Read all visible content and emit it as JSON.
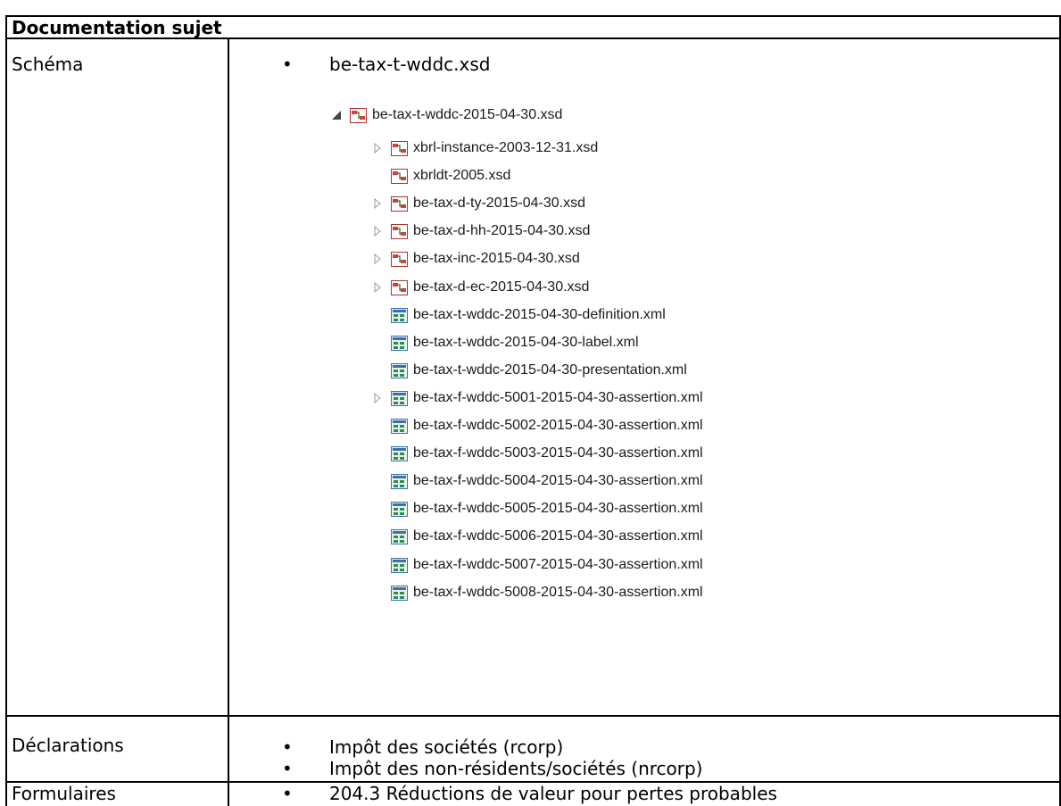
{
  "header": {
    "title": "Documentation sujet"
  },
  "schema": {
    "label": "Schéma",
    "bullet": "be-tax-t-wddc.xsd",
    "tree": {
      "root": {
        "label": "be-tax-t-wddc-2015-04-30.xsd",
        "icon": "xsd-icon",
        "expanded": true
      },
      "children": [
        {
          "label": "xbrl-instance-2003-12-31.xsd",
          "icon": "xsd-icon",
          "expandable": true
        },
        {
          "label": "xbrldt-2005.xsd",
          "icon": "xsd-icon",
          "expandable": false
        },
        {
          "label": "be-tax-d-ty-2015-04-30.xsd",
          "icon": "xsd-icon",
          "expandable": true
        },
        {
          "label": "be-tax-d-hh-2015-04-30.xsd",
          "icon": "xsd-icon",
          "expandable": true
        },
        {
          "label": "be-tax-inc-2015-04-30.xsd",
          "icon": "xsd-icon",
          "expandable": true
        },
        {
          "label": "be-tax-d-ec-2015-04-30.xsd",
          "icon": "xsd-icon",
          "expandable": true
        },
        {
          "label": "be-tax-t-wddc-2015-04-30-definition.xml",
          "icon": "xml-icon",
          "expandable": false
        },
        {
          "label": "be-tax-t-wddc-2015-04-30-label.xml",
          "icon": "xml-icon",
          "expandable": false
        },
        {
          "label": "be-tax-t-wddc-2015-04-30-presentation.xml",
          "icon": "xml-icon",
          "expandable": false
        },
        {
          "label": "be-tax-f-wddc-5001-2015-04-30-assertion.xml",
          "icon": "xml-icon",
          "expandable": true
        },
        {
          "label": "be-tax-f-wddc-5002-2015-04-30-assertion.xml",
          "icon": "xml-icon",
          "expandable": false
        },
        {
          "label": "be-tax-f-wddc-5003-2015-04-30-assertion.xml",
          "icon": "xml-icon",
          "expandable": false
        },
        {
          "label": "be-tax-f-wddc-5004-2015-04-30-assertion.xml",
          "icon": "xml-icon",
          "expandable": false
        },
        {
          "label": "be-tax-f-wddc-5005-2015-04-30-assertion.xml",
          "icon": "xml-icon",
          "expandable": false
        },
        {
          "label": "be-tax-f-wddc-5006-2015-04-30-assertion.xml",
          "icon": "xml-icon",
          "expandable": false
        },
        {
          "label": "be-tax-f-wddc-5007-2015-04-30-assertion.xml",
          "icon": "xml-icon",
          "expandable": false
        },
        {
          "label": "be-tax-f-wddc-5008-2015-04-30-assertion.xml",
          "icon": "xml-icon",
          "expandable": false
        }
      ]
    }
  },
  "declarations": {
    "label": "Déclarations",
    "items": [
      "Impôt des sociétés (rcorp)",
      "Impôt des non-résidents/sociétés (nrcorp)"
    ]
  },
  "forms": {
    "label": "Formulaires",
    "items": [
      "204.3 Réductions de valeur pour pertes probables"
    ]
  },
  "colors": {
    "border": "#000000",
    "xsd_icon": "#c0392b",
    "xml_icon": "#2e8b57",
    "tree_text": "#1a1a1a"
  }
}
